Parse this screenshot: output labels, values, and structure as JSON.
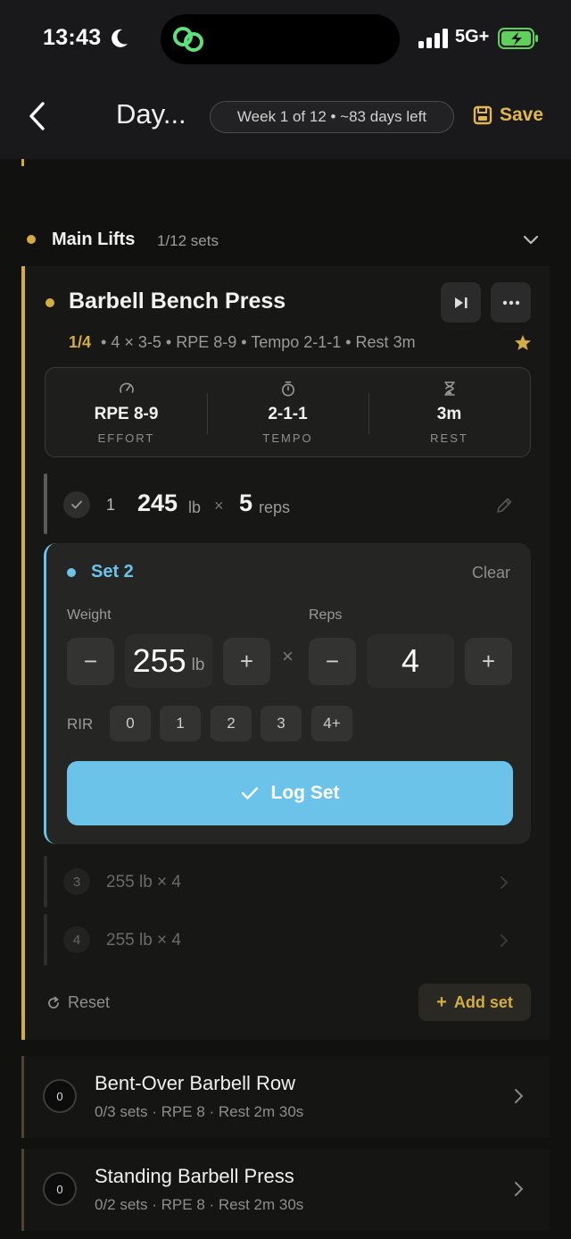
{
  "status_bar": {
    "time": "13:43",
    "network": "5G+"
  },
  "header": {
    "title": "Day...",
    "program_pill": "Week 1 of 12 • ~83 days left",
    "save_label": "Save"
  },
  "section": {
    "title": "Main Lifts",
    "count": "1/12 sets"
  },
  "exercise": {
    "name": "Barbell Bench Press",
    "progress": "1/4",
    "meta": "•  4 × 3-5 • RPE 8-9 • Tempo 2-1-1 • Rest 3m",
    "stats": [
      {
        "icon": "gauge-icon",
        "value": "RPE 8-9",
        "label": "EFFORT"
      },
      {
        "icon": "stopwatch-icon",
        "value": "2-1-1",
        "label": "TEMPO"
      },
      {
        "icon": "hourglass-icon",
        "value": "3m",
        "label": "REST"
      }
    ]
  },
  "logged_set": {
    "number": "1",
    "weight": "245",
    "weight_unit": "lb",
    "times": "×",
    "reps": "5",
    "reps_unit": "reps"
  },
  "active_set": {
    "title": "Set 2",
    "clear_label": "Clear",
    "weight_label": "Weight",
    "reps_label": "Reps",
    "weight_value": "255",
    "weight_unit": "lb",
    "reps_value": "4",
    "minus": "−",
    "plus": "+",
    "times": "×",
    "rir_label": "RIR",
    "rir_options": [
      "0",
      "1",
      "2",
      "3",
      "4+"
    ],
    "log_label": "Log Set",
    "accent_color": "#6cc3ea"
  },
  "pending_sets": [
    {
      "number": "3",
      "text": "255 lb × 4"
    },
    {
      "number": "4",
      "text": "255 lb × 4"
    }
  ],
  "reset_label": "Reset",
  "add_set_label": "Add set",
  "other_exercises": [
    {
      "count": "0",
      "name": "Bent-Over Barbell Row",
      "meta": "0/3 sets  ·  RPE 8  ·  Rest 2m 30s"
    },
    {
      "count": "0",
      "name": "Standing Barbell Press",
      "meta": "0/2 sets  ·  RPE 8  ·  Rest 2m 30s"
    }
  ],
  "colors": {
    "accent_gold": "#d4ad40",
    "accent_blue": "#6cc3ea",
    "background": "#111110"
  }
}
